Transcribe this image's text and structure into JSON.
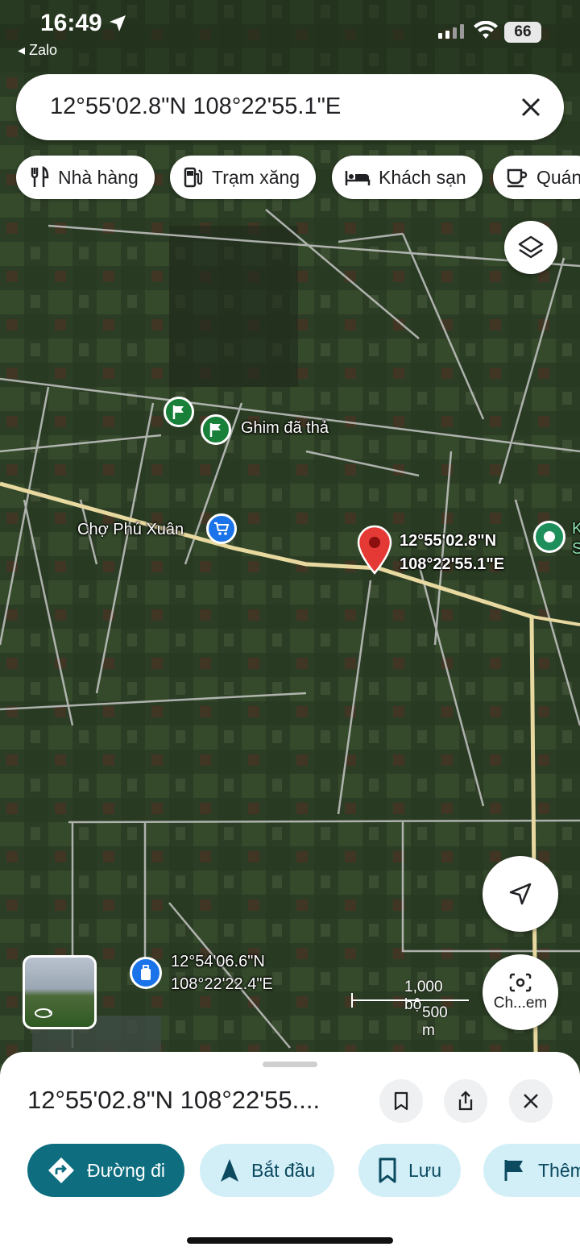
{
  "status_bar": {
    "time": "16:49",
    "back_app": "◂ Zalo",
    "battery": "66"
  },
  "search": {
    "query": "12°55'02.8\"N 108°22'55.1\"E",
    "close_icon": "close-icon"
  },
  "chips": [
    {
      "label": "Nhà hàng",
      "icon": "restaurant-icon"
    },
    {
      "label": "Trạm xăng",
      "icon": "gas-station-icon"
    },
    {
      "label": "Khách sạn",
      "icon": "hotel-icon"
    },
    {
      "label": "Quán",
      "icon": "coffee-icon"
    }
  ],
  "map": {
    "dropped_pin_label": "Ghim đã thả",
    "market_label": "Chợ Phú Xuân",
    "selected_pin": {
      "line1": "12°55'02.8\"N",
      "line2": "108°22'55.1\"E"
    },
    "saved_place": {
      "line1": "12°54'06.6\"N",
      "line2": "108°22'22.4\"E"
    },
    "edge_place": {
      "line1": "K",
      "line2": "S"
    },
    "scale": {
      "imperial": "1,000 bộ",
      "metric": "500 m"
    },
    "camera_button_label": "Ch...em"
  },
  "sheet": {
    "title": "12°55'02.8\"N 108°22'55....",
    "actions": [
      {
        "label": "Đường đi",
        "icon": "directions-icon"
      },
      {
        "label": "Bắt đầu",
        "icon": "navigate-arrow-icon"
      },
      {
        "label": "Lưu",
        "icon": "bookmark-icon"
      },
      {
        "label": "Thêm",
        "icon": "flag-icon"
      }
    ]
  },
  "colors": {
    "accent": "#0e6e80",
    "action_bg": "#d2eef7",
    "pin_red": "#e53935",
    "road_yellow": "#e8d9a0"
  }
}
